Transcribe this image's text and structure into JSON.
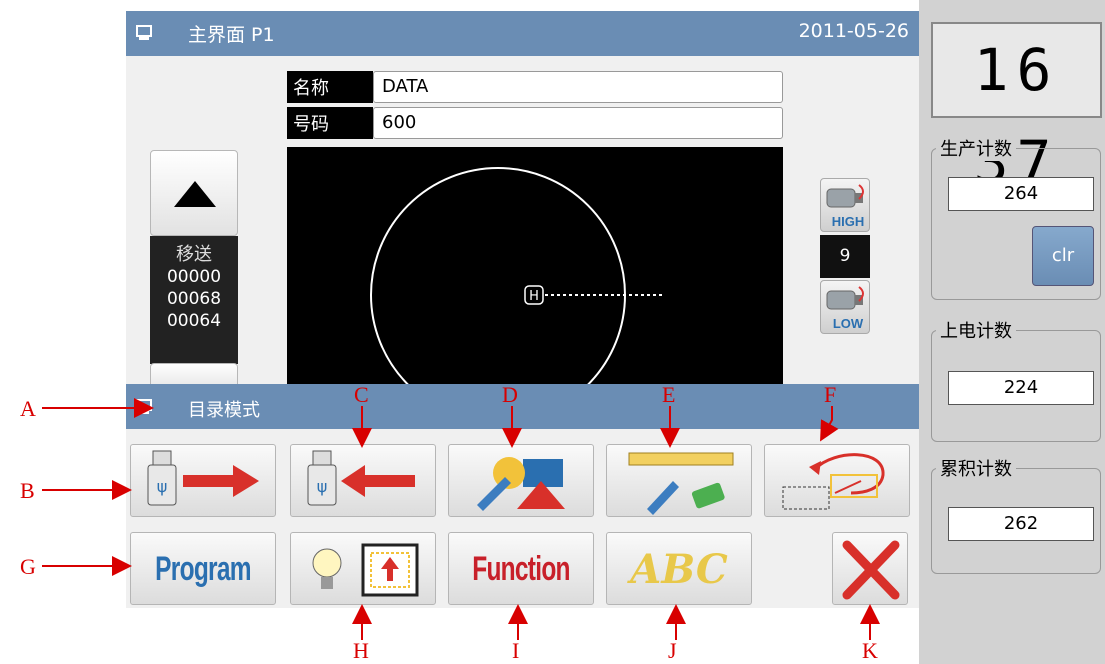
{
  "header": {
    "title": "主界面  P1",
    "date": "2011-05-26"
  },
  "pattern": {
    "name_label": "名称",
    "name_value": "DATA",
    "number_label": "号码",
    "number_value": "600",
    "home_marker": "H"
  },
  "feed": {
    "label": "移送",
    "values": [
      "00000",
      "00068",
      "00064"
    ]
  },
  "speed": {
    "high_label": "HIGH",
    "value": "9",
    "low_label": "LOW"
  },
  "mode_bar": {
    "title": "目录模式"
  },
  "buttons": {
    "program": "Program",
    "function": "Function",
    "abc": "ABC"
  },
  "right_panel": {
    "clock": "16 37",
    "production_count_label": "生产计数",
    "production_count": "264",
    "clear_label": "clr",
    "power_on_count_label": "上电计数",
    "power_on_count": "224",
    "cumulative_count_label": "累积计数",
    "cumulative_count": "262"
  },
  "annotations": [
    "A",
    "B",
    "C",
    "D",
    "E",
    "F",
    "G",
    "H",
    "I",
    "J",
    "K"
  ],
  "colors": {
    "title_bar": "#6a8db4",
    "annotation": "#d80000",
    "usb_arrow": "#d8302a",
    "program_text": "#2a6fb0",
    "function_text": "#c8202a"
  }
}
